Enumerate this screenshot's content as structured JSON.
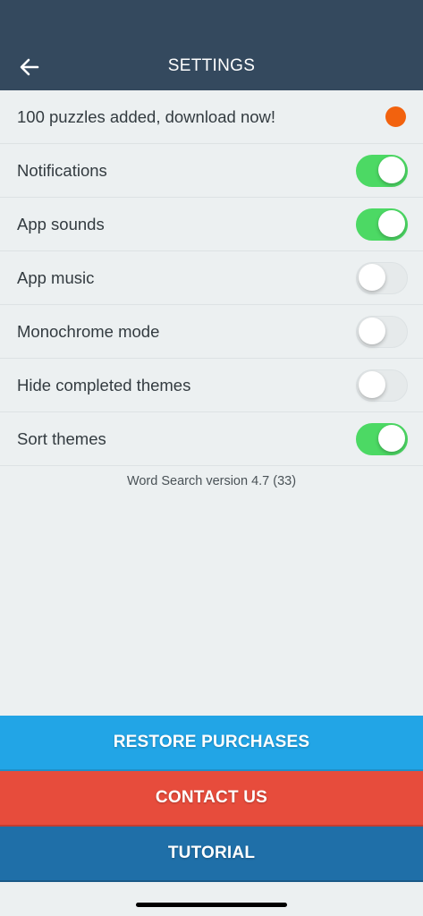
{
  "header": {
    "title": "SETTINGS",
    "back_icon": "arrow-left-icon",
    "background": "#34495e"
  },
  "notice": {
    "label": "100 puzzles added, download now!",
    "dot_color": "#f2620e"
  },
  "settings": [
    {
      "label": "Notifications",
      "on": true
    },
    {
      "label": "App sounds",
      "on": true
    },
    {
      "label": "App music",
      "on": false
    },
    {
      "label": "Monochrome mode",
      "on": false
    },
    {
      "label": "Hide completed themes",
      "on": false
    },
    {
      "label": "Sort themes",
      "on": true
    }
  ],
  "version": "Word Search version 4.7 (33)",
  "buttons": {
    "restore": "RESTORE PURCHASES",
    "contact": "CONTACT US",
    "tutorial": "TUTORIAL"
  },
  "colors": {
    "toggle_on": "#4cd964",
    "restore": "#22a5e6",
    "contact": "#e74c3c",
    "tutorial": "#1f6fa8"
  }
}
